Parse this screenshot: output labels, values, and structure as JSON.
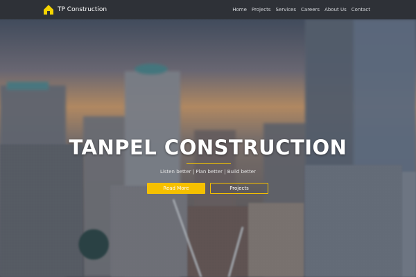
{
  "header": {
    "brand": "TP Construction",
    "nav": [
      "Home",
      "Projects",
      "Services",
      "Careers",
      "About Us",
      "Contact"
    ]
  },
  "hero": {
    "title": "TANPEL CONSTRUCTION",
    "tagline": "Listen better | Plan better | Build better",
    "primary_button": "Read More",
    "secondary_button": "Projects"
  },
  "colors": {
    "accent": "#f5c000",
    "navbar": "#2e3137",
    "logo": "#f5d400"
  },
  "icons": {
    "logo": "house-logo-icon"
  }
}
